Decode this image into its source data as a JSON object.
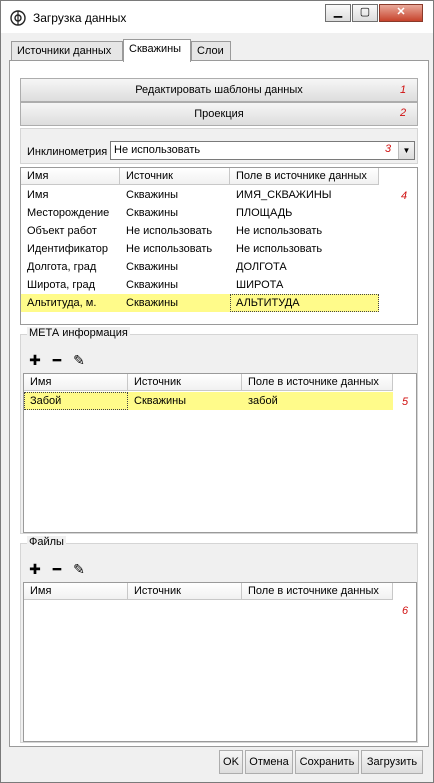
{
  "window": {
    "title": "Загрузка данных",
    "icon": "gear-logo-icon"
  },
  "tabs": [
    {
      "label": "Источники данных"
    },
    {
      "label": "Скважины"
    },
    {
      "label": "Слои"
    }
  ],
  "buttons": {
    "edit_templates": "Редактировать шаблоны данных",
    "projection": "Проекция"
  },
  "markers": [
    "1",
    "2",
    "3",
    "4",
    "5",
    "6"
  ],
  "inclinometry": {
    "label": "Инклинометрия",
    "value": "Не использовать"
  },
  "mapping_grid": {
    "headers": [
      "Имя",
      "Источник",
      "Поле в источнике данных"
    ],
    "rows": [
      [
        "Имя",
        "Скважины",
        "ИМЯ_СКВАЖИНЫ"
      ],
      [
        "Месторождение",
        "Скважины",
        "ПЛОЩАДЬ"
      ],
      [
        "Объект работ",
        "Не использовать",
        "Не использовать"
      ],
      [
        "Идентификатор",
        "Не использовать",
        "Не использовать"
      ],
      [
        "Долгота, град",
        "Скважины",
        "ДОЛГОТА"
      ],
      [
        "Широта, град",
        "Скважины",
        "ШИРОТА"
      ],
      [
        "Альтитуда, м.",
        "Скважины",
        "АЛЬТИТУДА"
      ]
    ]
  },
  "meta": {
    "title": "МЕТА информация",
    "headers": [
      "Имя",
      "Источник",
      "Поле в источнике данных"
    ],
    "rows": [
      [
        "Забой",
        "Скважины",
        "забой"
      ]
    ]
  },
  "files": {
    "title": "Файлы",
    "headers": [
      "Имя",
      "Источник",
      "Поле в источнике данных"
    ]
  },
  "footer": {
    "ok": "OK",
    "cancel": "Отмена",
    "save": "Сохранить",
    "load": "Загрузить"
  },
  "colors": {
    "highlight": "#fffb8a",
    "marker": "#d01010"
  }
}
